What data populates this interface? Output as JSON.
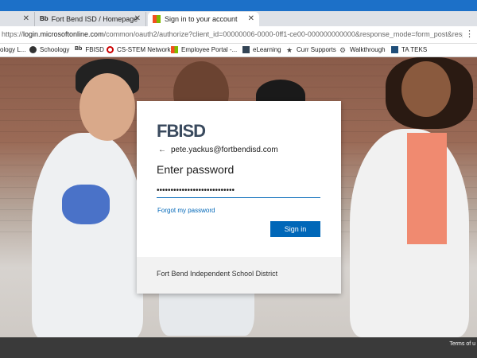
{
  "browser": {
    "tabs": [
      {
        "label": "",
        "favicon": "blank"
      },
      {
        "label": "Fort Bend ISD / Homepage",
        "favicon": "blackboard-icon"
      },
      {
        "label": "Sign in to your account",
        "favicon": "microsoft-icon"
      }
    ],
    "new_tab": "+",
    "url_prefix": "https://",
    "url_host": "login.microsoftonline.com",
    "url_path": "/common/oauth2/authorize?client_id=00000006-0000-0ff1-ce00-000000000000&response_mode=form_post&response_type...",
    "bookmarks": [
      "ology L...",
      "Schoology",
      "FBISD",
      "CS-STEM Network",
      "Employee Portal -...",
      "eLearning",
      "Curr Supports",
      "Walkthrough",
      "TA TEKS"
    ]
  },
  "signin": {
    "logo": "FBISD",
    "email": "pete.yackus@fortbendisd.com",
    "heading": "Enter password",
    "password_mask": "••••••••••••••••••••••••••••",
    "forgot": "Forgot my password",
    "button": "Sign in",
    "footer": "Fort Bend Independent School District"
  },
  "footer": {
    "terms": "Terms of u"
  },
  "colors": {
    "accent": "#0067b8",
    "browser_blue": "#1c70c8"
  }
}
